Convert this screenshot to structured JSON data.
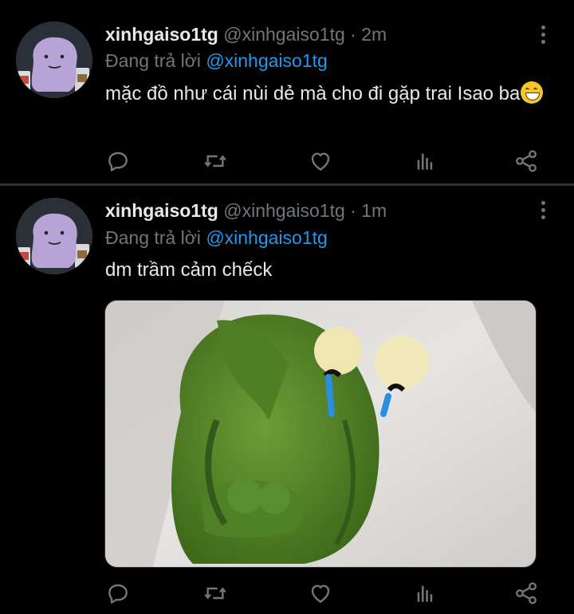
{
  "tweets": [
    {
      "display_name": "xinhgaiso1tg",
      "handle": "@xinhgaiso1tg",
      "separator": "·",
      "time": "2m",
      "reply_prefix": "Đang trả lời",
      "reply_to": "@xinhgaiso1tg",
      "text": "mặc đồ như cái nùi dẻ mà cho đi gặp trai Isao ba",
      "emoji": "grinning-face-with-smiling-eyes"
    },
    {
      "display_name": "xinhgaiso1tg",
      "handle": "@xinhgaiso1tg",
      "separator": "·",
      "time": "1m",
      "reply_prefix": "Đang trả lời",
      "reply_to": "@xinhgaiso1tg",
      "text": "dm trầm cảm chếck",
      "media": "sad-kermit-photo"
    }
  ],
  "icons": {
    "reply": "reply-icon",
    "retweet": "retweet-icon",
    "like": "like-icon",
    "stats": "stats-icon",
    "share": "share-icon",
    "more": "more-icon"
  },
  "colors": {
    "background": "#000000",
    "text": "#e7e9ea",
    "muted": "#71767b",
    "link": "#1d9bf0",
    "divider": "#2f3336"
  }
}
